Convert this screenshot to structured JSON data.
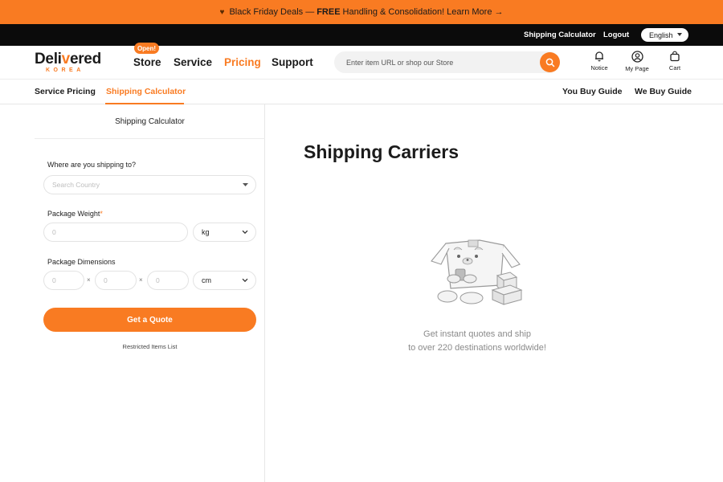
{
  "promo": {
    "prefix": "Black Friday Deals —",
    "bold": "FREE",
    "suffix": "Handling & Consolidation! Learn More →",
    "icon": "heart-icon"
  },
  "utility": {
    "calculator_link": "Shipping Calculator",
    "logout_link": "Logout",
    "language": "English"
  },
  "header": {
    "logo_word": "Deli",
    "logo_v": "v",
    "logo_word_end": "ered",
    "logo_sub": "KOREA",
    "open_badge": "Open!",
    "nav": [
      "Store",
      "Service",
      "Pricing",
      "Support"
    ],
    "active_nav": "Pricing",
    "search_placeholder": "Enter item URL or shop our Store",
    "icons": [
      {
        "label": "Notice",
        "icon": "bell-icon"
      },
      {
        "label": "My Page",
        "icon": "user-icon"
      },
      {
        "label": "Cart",
        "icon": "cart-icon"
      }
    ]
  },
  "subnav": {
    "left": [
      "Service Pricing",
      "Shipping Calculator"
    ],
    "active": "Shipping Calculator",
    "right": [
      "You Buy Guide",
      "We Buy Guide"
    ]
  },
  "calculator": {
    "title": "Shipping Calculator",
    "country_label": "Where are you shipping to?",
    "country_placeholder": "Search Country",
    "weight_label": "Package Weight",
    "weight_required": "*",
    "weight_placeholder": "0",
    "weight_unit": "kg",
    "dims_label": "Package Dimensions",
    "dim_placeholder": "0",
    "dim_separator": "×",
    "dims_unit": "cm",
    "quote_button": "Get a Quote",
    "restricted_link": "Restricted Items List"
  },
  "carriers": {
    "heading": "Shipping Carriers",
    "empty_line1": "Get instant quotes and ship",
    "empty_line2": "to over 220 destinations worldwide!"
  },
  "colors": {
    "accent": "#f97b22",
    "topbar": "#0b0b0b"
  }
}
